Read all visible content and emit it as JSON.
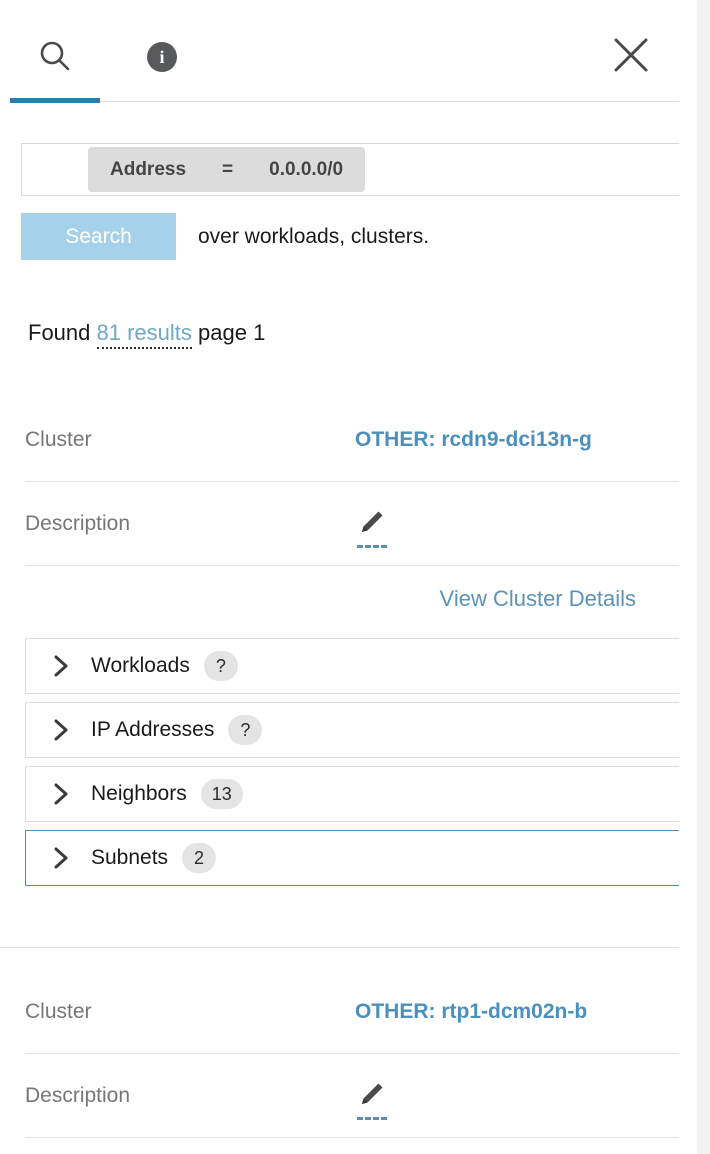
{
  "header": {
    "tabs": [
      {
        "name": "search",
        "icon": "search-icon",
        "active": true
      },
      {
        "name": "info",
        "icon": "info-icon",
        "label": "i",
        "active": false
      }
    ],
    "close_label": "×"
  },
  "search": {
    "chip": {
      "field": "Address",
      "operator": "=",
      "value": "0.0.0.0/0"
    },
    "button_label": "Search",
    "scope_text": "over workloads, clusters."
  },
  "results": {
    "prefix": "Found",
    "count_label": "81 results",
    "page_label": "page 1"
  },
  "blocks": [
    {
      "cluster_label": "Cluster",
      "cluster_value": "OTHER: rcdn9-dci13n-g",
      "description_label": "Description",
      "details_link": "View Cluster Details",
      "accordions": [
        {
          "label": "Workloads",
          "badge": "?",
          "active": false
        },
        {
          "label": "IP Addresses",
          "badge": "?",
          "active": false
        },
        {
          "label": "Neighbors",
          "badge": "13",
          "active": false
        },
        {
          "label": "Subnets",
          "badge": "2",
          "active": true
        }
      ]
    },
    {
      "cluster_label": "Cluster",
      "cluster_value": "OTHER: rtp1-dcm02n-b",
      "description_label": "Description"
    }
  ],
  "colors": {
    "accent_blue": "#2e7cb0",
    "link_blue": "#4b8fbd",
    "muted_link": "#5b93b8",
    "button_blue": "#a6d1ea",
    "badge_gray": "#e4e4e4",
    "chip_gray": "#dcdcdc"
  }
}
